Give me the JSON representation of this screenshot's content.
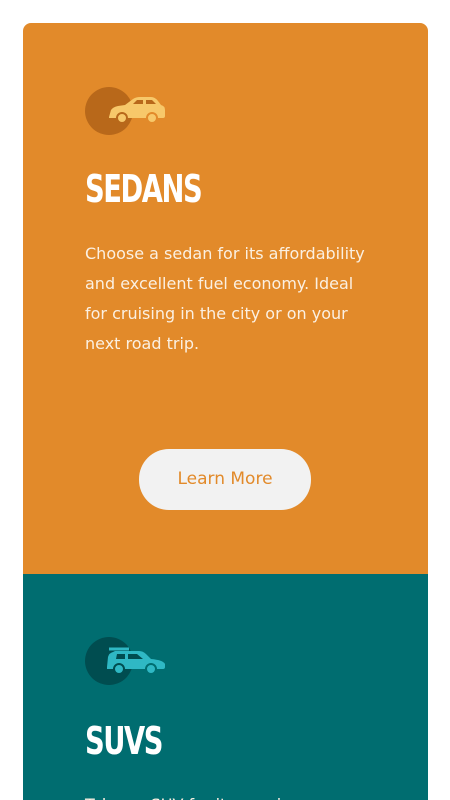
{
  "colors": {
    "sedans_bg": "#e28a2a",
    "suvs_bg": "#006d70",
    "button_bg": "#f2f2f2",
    "button_text": "#e28a2a",
    "sedan_icon": "#f7c86a",
    "suv_icon": "#2fb8c4"
  },
  "cards": [
    {
      "icon": "sedan-car-icon",
      "title": "SEDANS",
      "description": "Choose a sedan for its affordability and excellent fuel economy. Ideal for cruising in the city or on your next road trip.",
      "button_label": "Learn More"
    },
    {
      "icon": "suv-car-icon",
      "title": "SUVS",
      "description": "Take an SUV for its spacious"
    }
  ]
}
